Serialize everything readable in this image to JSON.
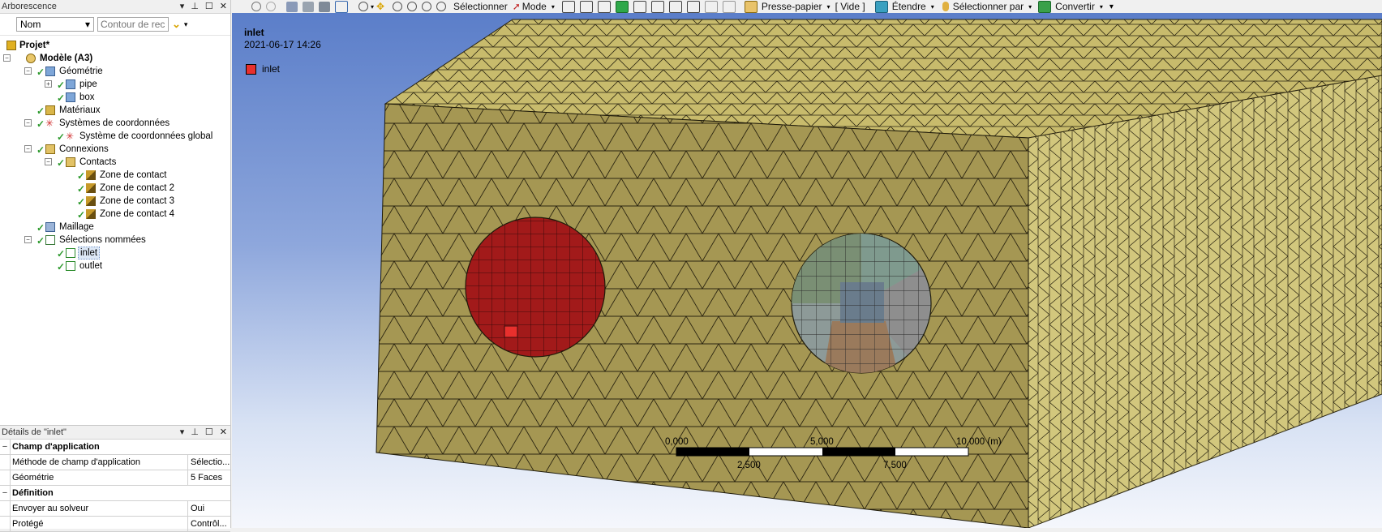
{
  "tree_panel": {
    "title": "Arborescence",
    "filter_select": "Nom",
    "search_placeholder": "Contour de rech",
    "items": [
      {
        "label": "Projet*",
        "bold": true
      },
      {
        "label": "Modèle (A3)",
        "bold": true
      },
      {
        "label": "Géométrie"
      },
      {
        "label": "pipe"
      },
      {
        "label": "box"
      },
      {
        "label": "Matériaux"
      },
      {
        "label": "Systèmes de coordonnées"
      },
      {
        "label": "Système de coordonnées global"
      },
      {
        "label": "Connexions"
      },
      {
        "label": "Contacts"
      },
      {
        "label": "Zone de contact"
      },
      {
        "label": "Zone de contact 2"
      },
      {
        "label": "Zone de contact 3"
      },
      {
        "label": "Zone de contact 4"
      },
      {
        "label": "Maillage"
      },
      {
        "label": "Sélections nommées"
      },
      {
        "label": "inlet"
      },
      {
        "label": "outlet"
      }
    ]
  },
  "details_panel": {
    "title": "Détails de \"inlet\"",
    "rows": [
      {
        "section": "Champ d'application"
      },
      {
        "key": "Méthode de champ d'application",
        "value": "Sélectio..."
      },
      {
        "key": "Géométrie",
        "value": "5 Faces"
      },
      {
        "section": "Définition"
      },
      {
        "key": "Envoyer au solveur",
        "value": "Oui"
      },
      {
        "key": "Protégé",
        "value": "Contrôl..."
      }
    ]
  },
  "toolbar": {
    "select_label": "Sélectionner",
    "mode_label": "Mode",
    "clipboard_label": "Presse-papier",
    "empty_label": "[ Vide ]",
    "extend_label": "Étendre",
    "select_by_label": "Sélectionner par",
    "convert_label": "Convertir"
  },
  "viewport": {
    "title": "inlet",
    "date": "2021-06-17 14:26",
    "legend_label": "inlet",
    "legend_color": "#e8302d",
    "mesh_color": "#c9bd72",
    "scale": {
      "labels_top": [
        "0,000",
        "5,000",
        "10,000 (m)"
      ],
      "labels_bottom": [
        "2,500",
        "7,500"
      ]
    }
  }
}
